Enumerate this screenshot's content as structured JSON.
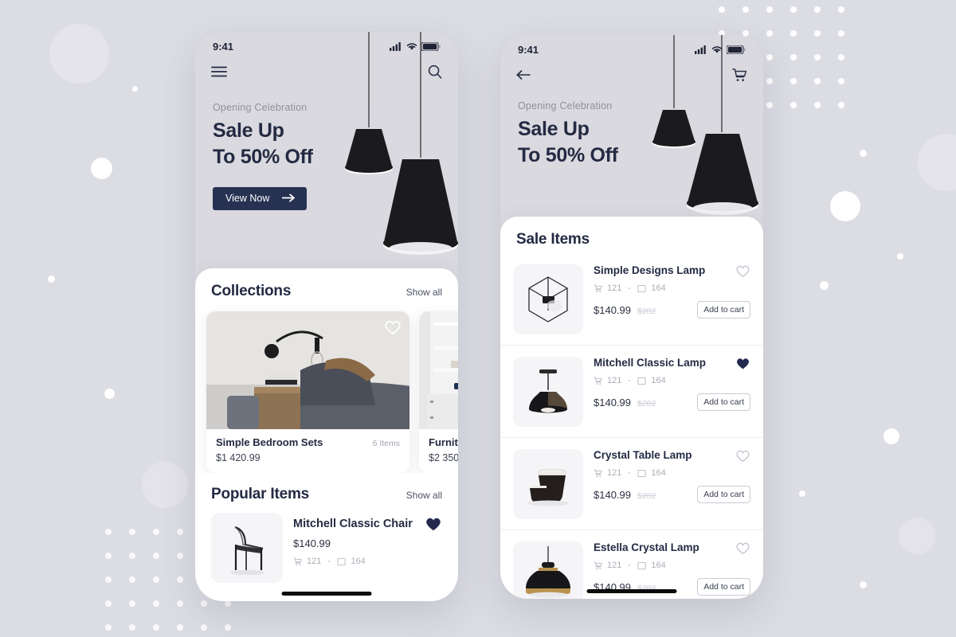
{
  "theme": {
    "background": "#dcdce3",
    "phone_bg": "#d9d9df",
    "sheet_bg": "#ffffff",
    "accent_navy": "#273253",
    "text_dark": "#232a42",
    "text_muted": "#8e909e",
    "heart_filled": "#232a4e"
  },
  "screen_left": {
    "status": {
      "time": "9:41",
      "signal_icon": "cellular-signal-icon",
      "wifi_icon": "wifi-icon",
      "battery_icon": "battery-icon"
    },
    "nav": {
      "menu_icon": "hamburger-menu-icon",
      "search_icon": "search-icon"
    },
    "hero": {
      "eyebrow": "Opening Celebration",
      "title_line1": "Sale Up",
      "title_line2": "To 50% Off",
      "cta_label": "View Now",
      "cta_icon": "arrow-right-icon",
      "art": "pendant-lamps-illustration"
    },
    "collections": {
      "title": "Collections",
      "show_all": "Show all",
      "cards": [
        {
          "name": "Simple Bedroom Sets",
          "count": "6 Items",
          "price": "$1 420.99",
          "image": "bedroom-with-wall-lamp-photo",
          "favorite": false,
          "fav_icon": "heart-outline-icon"
        },
        {
          "name": "Furnit",
          "count": "",
          "price": "$2 350",
          "image": "white-shelving-unit-photo",
          "favorite": false,
          "fav_icon": "heart-outline-icon"
        }
      ]
    },
    "popular": {
      "title": "Popular Items",
      "show_all": "Show all",
      "items": [
        {
          "name": "Mitchell Classic Chair",
          "price": "$140.99",
          "cart_icon": "cart-icon",
          "cart_count": "121",
          "box_icon": "box-icon",
          "box_count": "164",
          "image": "black-classic-chair-photo",
          "favorite": true,
          "fav_icon": "heart-filled-icon"
        }
      ]
    }
  },
  "screen_right": {
    "status": {
      "time": "9:41",
      "signal_icon": "cellular-signal-icon",
      "wifi_icon": "wifi-icon",
      "battery_icon": "battery-icon"
    },
    "nav": {
      "back_icon": "arrow-left-icon",
      "cart_icon": "shopping-cart-icon"
    },
    "hero": {
      "eyebrow": "Opening Celebration",
      "title_line1": "Sale Up",
      "title_line2": "To 50% Off",
      "art": "pendant-lamps-illustration"
    },
    "sale": {
      "title": "Sale Items",
      "add_to_cart_label": "Add to cart",
      "items": [
        {
          "name": "Simple Designs Lamp",
          "price": "$140.99",
          "old_price": "$282",
          "cart_icon": "cart-icon",
          "cart_count": "121",
          "box_icon": "box-icon",
          "box_count": "164",
          "image": "wireframe-cube-lamp-photo",
          "favorite": false,
          "fav_icon": "heart-outline-icon"
        },
        {
          "name": "Mitchell Classic Lamp",
          "price": "$140.99",
          "old_price": "$282",
          "cart_icon": "cart-icon",
          "cart_count": "121",
          "box_icon": "box-icon",
          "box_count": "164",
          "image": "black-pendant-lamp-photo",
          "favorite": true,
          "fav_icon": "heart-filled-icon"
        },
        {
          "name": "Crystal Table Lamp",
          "price": "$140.99",
          "old_price": "$282",
          "cart_icon": "cart-icon",
          "cart_count": "121",
          "box_icon": "box-icon",
          "box_count": "164",
          "image": "black-white-table-lamps-photo",
          "favorite": false,
          "fav_icon": "heart-outline-icon"
        },
        {
          "name": "Estella  Crystal Lamp",
          "price": "$140.99",
          "old_price": "$282",
          "cart_icon": "cart-icon",
          "cart_count": "121",
          "box_icon": "box-icon",
          "box_count": "164",
          "image": "dome-pendant-lamp-photo",
          "favorite": false,
          "fav_icon": "heart-outline-icon"
        }
      ]
    }
  }
}
